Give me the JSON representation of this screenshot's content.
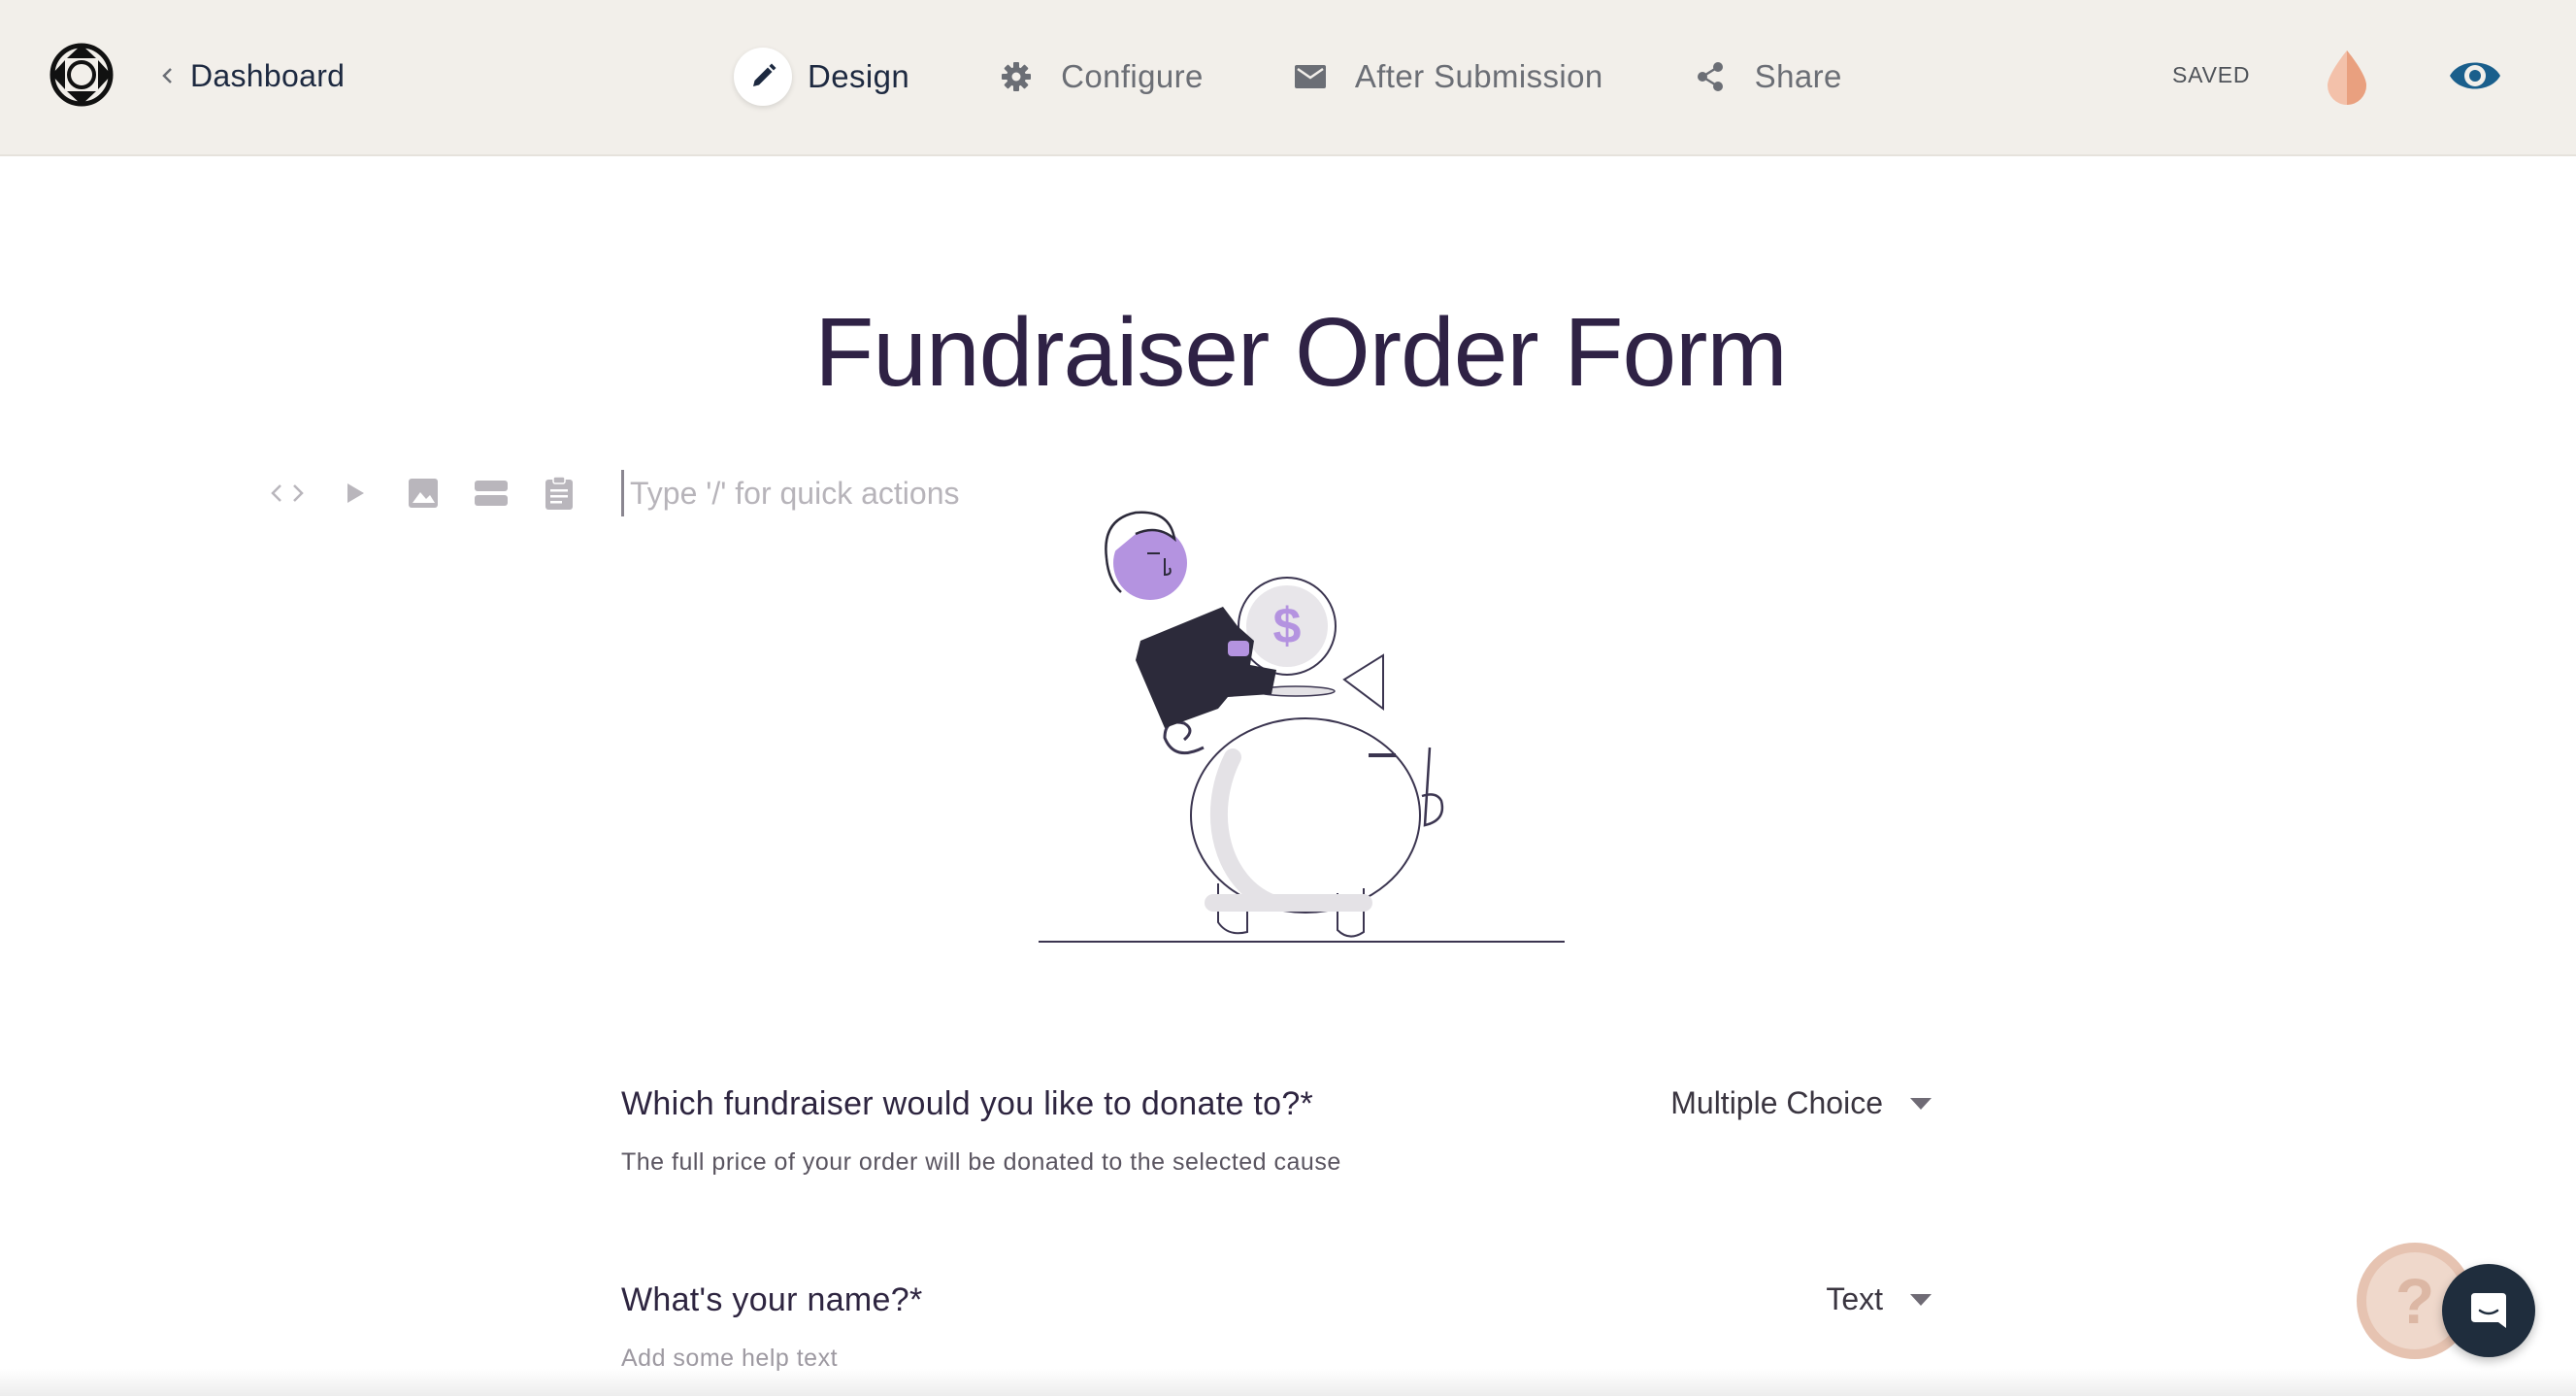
{
  "header": {
    "back_label": "Dashboard",
    "tabs": [
      {
        "label": "Design",
        "icon": "pencil-icon",
        "active": true
      },
      {
        "label": "Configure",
        "icon": "gear-icon",
        "active": false
      },
      {
        "label": "After Submission",
        "icon": "envelope-icon",
        "active": false
      },
      {
        "label": "Share",
        "icon": "share-icon",
        "active": false
      }
    ],
    "status": "SAVED",
    "theme_icon": "drop-icon",
    "preview_icon": "eye-icon"
  },
  "form": {
    "title": "Fundraiser Order Form",
    "quick_actions_placeholder": "Type '/' for quick actions",
    "toolbar_icons": [
      "code-icon",
      "play-icon",
      "image-icon",
      "layout-icon",
      "clipboard-icon"
    ],
    "questions": [
      {
        "label": "Which fundraiser would you like to donate to?*",
        "help": "The full price of your order will be donated to the selected cause",
        "type": "Multiple Choice"
      },
      {
        "label": "What's your name?*",
        "help_placeholder": "Add some help text",
        "type": "Text"
      }
    ]
  },
  "widgets": {
    "help_glyph": "?",
    "chat_icon": "chat-icon"
  },
  "colors": {
    "topbar_bg": "#f2efea",
    "title": "#2f2245",
    "accent_purple": "#b493e0",
    "drop_orange": "#e9a07f",
    "eye_blue": "#1a5f8c",
    "chat_bg": "#1f2d3d"
  }
}
